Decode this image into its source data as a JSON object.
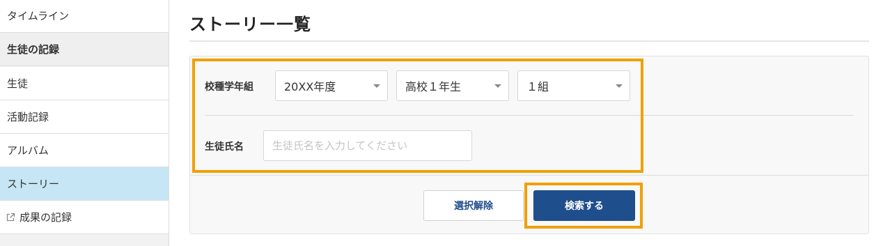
{
  "sidebar": {
    "items": [
      {
        "label": "タイムライン"
      },
      {
        "label": "生徒の記録"
      },
      {
        "label": "生徒"
      },
      {
        "label": "活動記録"
      },
      {
        "label": "アルバム"
      },
      {
        "label": "ストーリー"
      },
      {
        "label": "成果の記録",
        "icon": "external-link-icon"
      }
    ],
    "active_item": "ストーリー"
  },
  "main": {
    "title": "ストーリー一覧",
    "form": {
      "grade_label": "校種学年組",
      "year_select": {
        "value": "20XX年度"
      },
      "grade_select": {
        "value": "高校１年生"
      },
      "class_select": {
        "value": "１組"
      },
      "name_label": "生徒氏名",
      "name_input": {
        "value": "",
        "placeholder": "生徒氏名を入力してください"
      }
    },
    "buttons": {
      "clear_label": "選択解除",
      "search_label": "検索する"
    }
  },
  "colors": {
    "active_bg": "#c6e6f5",
    "primary": "#1f4e8c",
    "highlight": "#f0a000"
  }
}
